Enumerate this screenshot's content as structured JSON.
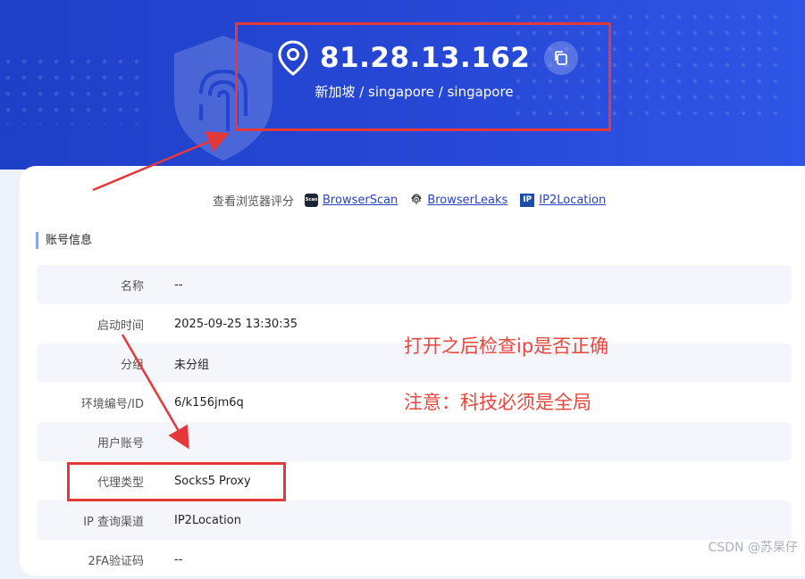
{
  "header": {
    "ip_address": "81.28.13.162",
    "location": "新加坡 / singapore / singapore"
  },
  "score_links": {
    "label": "查看浏览器评分",
    "scan_badge_text": "Scan",
    "ip_badge_text": "IP",
    "items": [
      "BrowserScan",
      "BrowserLeaks",
      "IP2Location"
    ]
  },
  "account": {
    "title": "账号信息",
    "rows": [
      {
        "label": "名称",
        "value": "--"
      },
      {
        "label": "启动时间",
        "value": "2025-09-25 13:30:35"
      },
      {
        "label": "分组",
        "value": "未分组"
      },
      {
        "label": "环境编号/ID",
        "value": "6/k156jm6q"
      },
      {
        "label": "用户账号",
        "value": ""
      },
      {
        "label": "代理类型",
        "value": "Socks5 Proxy"
      },
      {
        "label": "IP 查询渠道",
        "value": "IP2Location"
      },
      {
        "label": "2FA验证码",
        "value": "--"
      }
    ]
  },
  "annotations": {
    "note1": "打开之后检查ip是否正确",
    "note2": "注意：科技必须是全局",
    "color": "#e5383b"
  },
  "watermark": "CSDN @苏杲仔",
  "colors": {
    "hero": "#2445d3",
    "link": "#2742c7",
    "annotation": "#e9463e"
  }
}
